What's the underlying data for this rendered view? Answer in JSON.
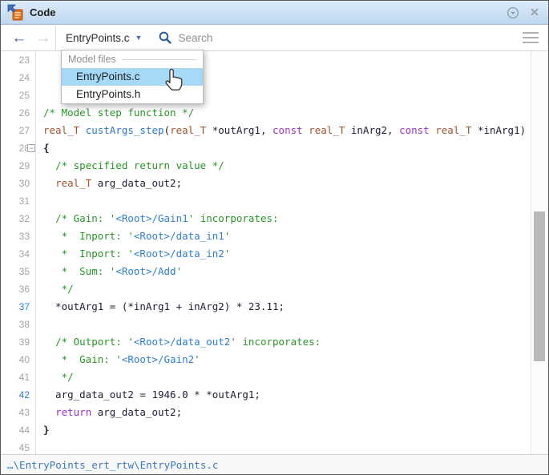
{
  "window": {
    "title": "Code",
    "icons": {
      "panel": "code-panel-icon",
      "collapse": "circle-chevron-down-icon",
      "close": "close-icon"
    }
  },
  "toolbar": {
    "back_icon": "back-arrow-icon",
    "forward_icon": "forward-arrow-icon",
    "file_selector": "EntryPoints.c",
    "caret_icon": "chevron-down-icon",
    "search_icon": "search-icon",
    "search_placeholder": "Search",
    "menu_icon": "hamburger-menu-icon"
  },
  "dropdown": {
    "header": "Model files",
    "items": [
      "EntryPoints.c",
      "EntryPoints.h"
    ],
    "selected": "EntryPoints.c",
    "highlight_color": "#a6d9f7",
    "cursor_icon": "hand-pointer-icon"
  },
  "editor": {
    "first_line": 23,
    "last_line": 45,
    "fold_line": 28,
    "highlighted_lines": [
      37,
      42
    ],
    "lines": [
      {
        "n": 23,
        "segs": []
      },
      {
        "n": 24,
        "segs": []
      },
      {
        "n": 25,
        "segs": []
      },
      {
        "n": 26,
        "segs": [
          {
            "c": "cm",
            "t": "/* Model step function */"
          }
        ]
      },
      {
        "n": 27,
        "segs": [
          {
            "c": "ty",
            "t": "real_T"
          },
          {
            "c": "pl",
            "t": " "
          },
          {
            "c": "fn",
            "t": "custArgs_step"
          },
          {
            "c": "pl",
            "t": "("
          },
          {
            "c": "ty",
            "t": "real_T"
          },
          {
            "c": "pl",
            "t": " *outArg1, "
          },
          {
            "c": "kw",
            "t": "const"
          },
          {
            "c": "pl",
            "t": " "
          },
          {
            "c": "ty",
            "t": "real_T"
          },
          {
            "c": "pl",
            "t": " inArg2, "
          },
          {
            "c": "kw",
            "t": "const"
          },
          {
            "c": "pl",
            "t": " "
          },
          {
            "c": "ty",
            "t": "real_T"
          },
          {
            "c": "pl",
            "t": " *inArg1)"
          }
        ]
      },
      {
        "n": 28,
        "segs": [
          {
            "c": "br",
            "t": "{"
          }
        ]
      },
      {
        "n": 29,
        "segs": [
          {
            "c": "pl",
            "t": "  "
          },
          {
            "c": "cm",
            "t": "/* specified return value */"
          }
        ]
      },
      {
        "n": 30,
        "segs": [
          {
            "c": "pl",
            "t": "  "
          },
          {
            "c": "ty",
            "t": "real_T"
          },
          {
            "c": "pl",
            "t": " arg_data_out2;"
          }
        ]
      },
      {
        "n": 31,
        "segs": []
      },
      {
        "n": 32,
        "segs": [
          {
            "c": "pl",
            "t": "  "
          },
          {
            "c": "cm",
            "t": "/* Gain: '"
          },
          {
            "c": "lk",
            "t": "<Root>/Gain1"
          },
          {
            "c": "cm",
            "t": "' incorporates:"
          }
        ]
      },
      {
        "n": 33,
        "segs": [
          {
            "c": "pl",
            "t": "   "
          },
          {
            "c": "cm",
            "t": "*  Inport: '"
          },
          {
            "c": "lk",
            "t": "<Root>/data_in1"
          },
          {
            "c": "cm",
            "t": "'"
          }
        ]
      },
      {
        "n": 34,
        "segs": [
          {
            "c": "pl",
            "t": "   "
          },
          {
            "c": "cm",
            "t": "*  Inport: '"
          },
          {
            "c": "lk",
            "t": "<Root>/data_in2"
          },
          {
            "c": "cm",
            "t": "'"
          }
        ]
      },
      {
        "n": 35,
        "segs": [
          {
            "c": "pl",
            "t": "   "
          },
          {
            "c": "cm",
            "t": "*  Sum: '"
          },
          {
            "c": "lk",
            "t": "<Root>/Add"
          },
          {
            "c": "cm",
            "t": "'"
          }
        ]
      },
      {
        "n": 36,
        "segs": [
          {
            "c": "pl",
            "t": "   "
          },
          {
            "c": "cm",
            "t": "*/"
          }
        ]
      },
      {
        "n": 37,
        "segs": [
          {
            "c": "pl",
            "t": "  *outArg1 = (*inArg1 + inArg2) * 23.11;"
          }
        ]
      },
      {
        "n": 38,
        "segs": []
      },
      {
        "n": 39,
        "segs": [
          {
            "c": "pl",
            "t": "  "
          },
          {
            "c": "cm",
            "t": "/* Outport: '"
          },
          {
            "c": "lk",
            "t": "<Root>/data_out2"
          },
          {
            "c": "cm",
            "t": "' incorporates:"
          }
        ]
      },
      {
        "n": 40,
        "segs": [
          {
            "c": "pl",
            "t": "   "
          },
          {
            "c": "cm",
            "t": "*  Gain: '"
          },
          {
            "c": "lk",
            "t": "<Root>/Gain2"
          },
          {
            "c": "cm",
            "t": "'"
          }
        ]
      },
      {
        "n": 41,
        "segs": [
          {
            "c": "pl",
            "t": "   "
          },
          {
            "c": "cm",
            "t": "*/"
          }
        ]
      },
      {
        "n": 42,
        "segs": [
          {
            "c": "pl",
            "t": "  arg_data_out2 = 1946.0 * *outArg1;"
          }
        ]
      },
      {
        "n": 43,
        "segs": [
          {
            "c": "pl",
            "t": "  "
          },
          {
            "c": "kw",
            "t": "return"
          },
          {
            "c": "pl",
            "t": " arg_data_out2;"
          }
        ]
      },
      {
        "n": 44,
        "segs": [
          {
            "c": "br",
            "t": "}"
          }
        ]
      },
      {
        "n": 45,
        "segs": []
      }
    ]
  },
  "status_bar": {
    "path": "…\\EntryPoints_ert_rtw\\EntryPoints.c"
  },
  "colors": {
    "titlebar_top": "#ddebfa",
    "titlebar_bottom": "#bed7ef",
    "comment_green": "#279627",
    "link_blue": "#2e7fd4",
    "type_maroon": "#a0522d",
    "keyword_purple": "#9b30c8",
    "function_blue": "#2e75c9",
    "line_highlight_blue": "#2e7fd4",
    "dropdown_highlight": "#a6d9f7",
    "status_path_blue": "#3b78ba"
  }
}
